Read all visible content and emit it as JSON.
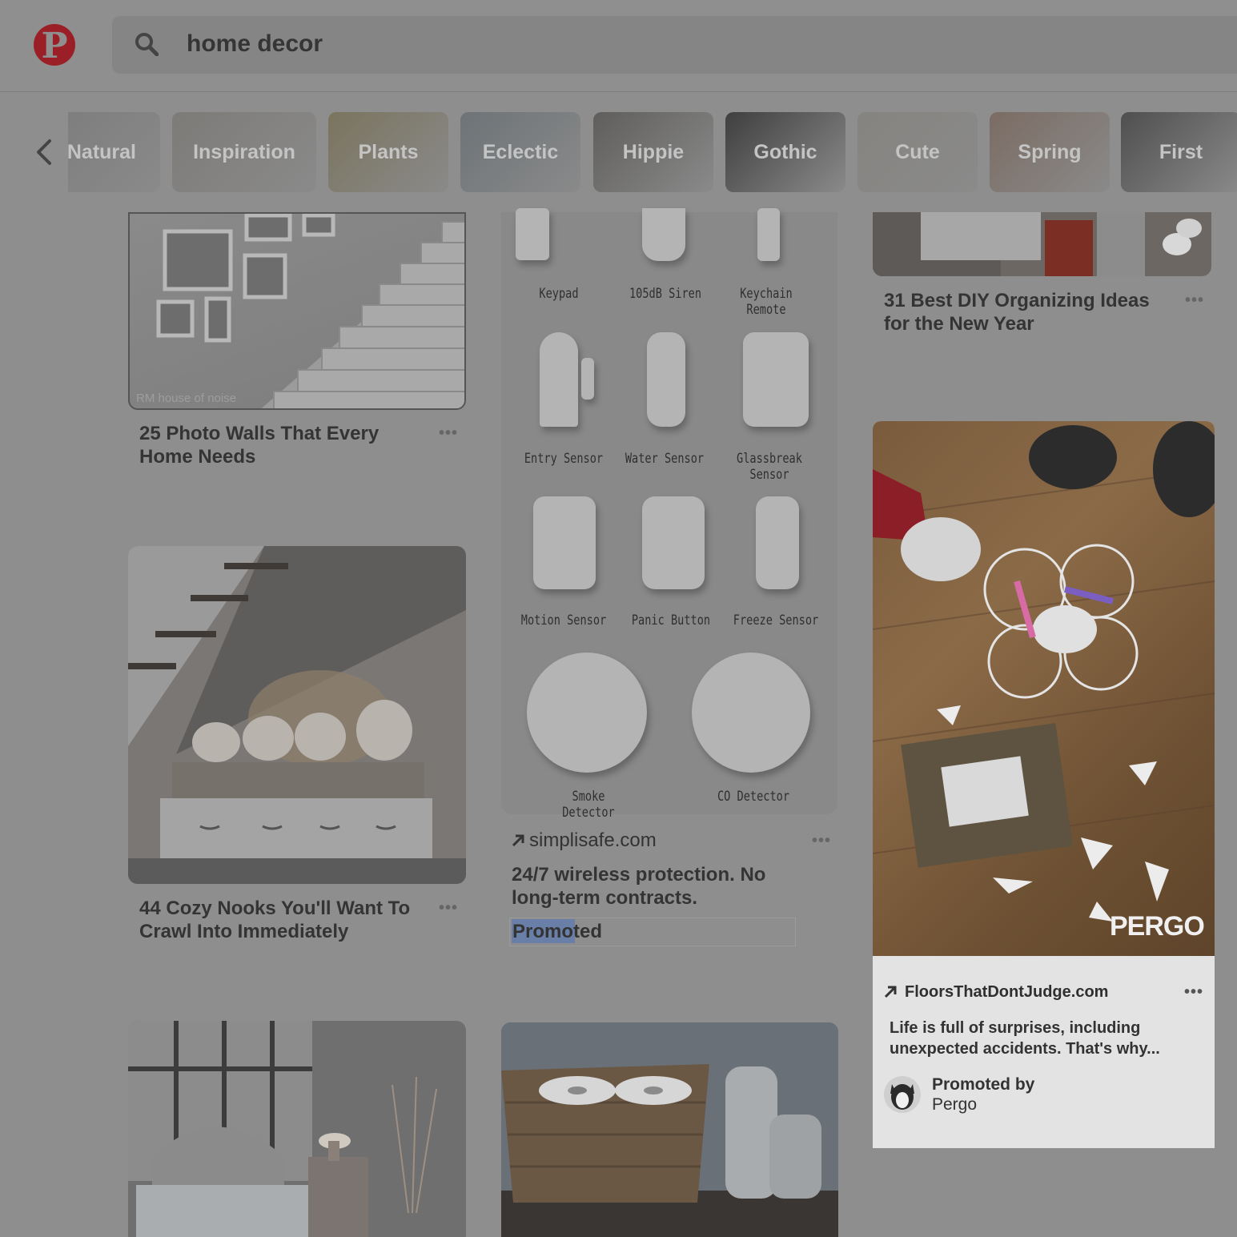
{
  "header": {
    "search_value": "home decor"
  },
  "chips": [
    "Natural",
    "Inspiration",
    "Plants",
    "Eclectic",
    "Hippie",
    "Gothic",
    "Cute",
    "Spring",
    "First"
  ],
  "pins": {
    "photo_walls": {
      "title_line1": "25 Photo Walls That Every",
      "title_line2": "Home Needs",
      "watermark": "RM house of noise"
    },
    "cozy_nooks": {
      "title_line1": "44 Cozy Nooks You'll Want To",
      "title_line2": "Crawl Into Immediately"
    },
    "organizing": {
      "title_line1": "31 Best DIY Organizing Ideas",
      "title_line2": "for the New Year"
    }
  },
  "products": {
    "labels": [
      "Keypad",
      "105dB Siren",
      "Keychain Remote",
      "Entry Sensor",
      "Water Sensor",
      "Glassbreak Sensor",
      "Motion Sensor",
      "Panic Button",
      "Freeze Sensor",
      "Smoke Detector",
      "CO Detector"
    ],
    "source": "simplisafe.com",
    "desc_line1": "24/7 wireless protection. No",
    "desc_line2": "long-term contracts.",
    "promoted": "Promoted"
  },
  "pergo": {
    "logo": "PERGO",
    "source": "FloorsThatDontJudge.com",
    "desc": "Life is full of surprises, including unexpected accidents. That's why...",
    "promoted_by": "Promoted by",
    "advertiser": "Pergo"
  },
  "dots": "•••",
  "colors": {
    "brand": "#9b1f26",
    "highlight": "#6a7fa8"
  }
}
